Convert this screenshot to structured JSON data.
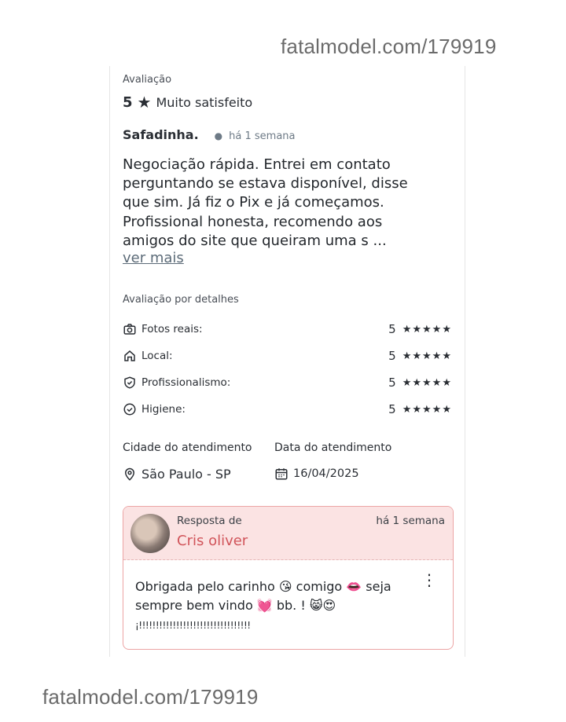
{
  "watermark": {
    "text": "fatalmodel.com/179919"
  },
  "review": {
    "rating_label": "Avaliação",
    "rating_value": "5",
    "rating_star": "★",
    "rating_text": "Muito satisfeito",
    "author": "Safadinha.",
    "posted": "há 1 semana",
    "body": "Negociação rápida. Entrei em contato perguntando se estava disponível, disse que sim. Já fiz o Pix e já começamos. Profissional honesta, recomendo aos amigos do site que queiram uma s ...",
    "more_link": "ver mais"
  },
  "details": {
    "title": "Avaliação por detalhes",
    "items": [
      {
        "label": "Fotos reais:",
        "score": "5",
        "stars": "★★★★★",
        "icon": "camera-icon"
      },
      {
        "label": "Local:",
        "score": "5",
        "stars": "★★★★★",
        "icon": "home-icon"
      },
      {
        "label": "Profissionalismo:",
        "score": "5",
        "stars": "★★★★★",
        "icon": "shield-check-icon"
      },
      {
        "label": "Higiene:",
        "score": "5",
        "stars": "★★★★★",
        "icon": "check-circle-icon"
      }
    ]
  },
  "service": {
    "city_label": "Cidade do atendimento",
    "city_value": "São Paulo - SP",
    "date_label": "Data do atendimento",
    "date_value": "16/04/2025"
  },
  "reply": {
    "label": "Resposta de",
    "name": "Cris oliver",
    "time": "há 1 semana",
    "text": "Obrigada pelo carinho 😘 comigo 👄 seja sempre bem vindo 💓 bb. ! 😸😍",
    "tail": "¡!!!!!!!!!!!!!!!!!!!!!!!!!!!!!!!!!",
    "menu_icon": "⋮"
  }
}
